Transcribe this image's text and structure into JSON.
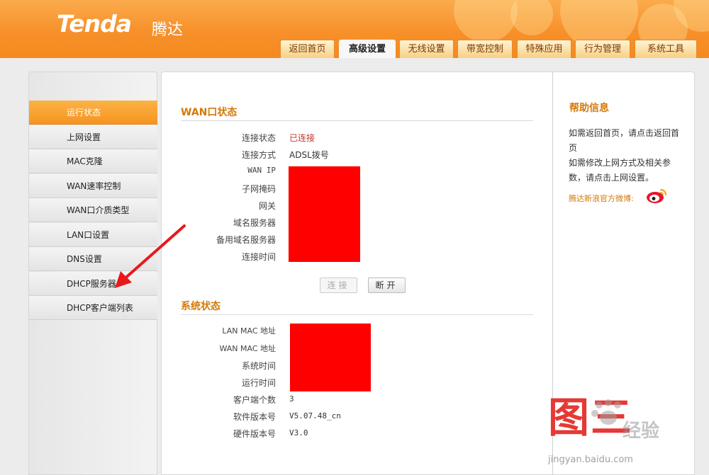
{
  "brand": {
    "logo_text": "Tenda",
    "logo_cn": "腾达"
  },
  "nav_tabs": [
    {
      "label": "返回首页"
    },
    {
      "label": "高级设置",
      "active": true
    },
    {
      "label": "无线设置"
    },
    {
      "label": "带宽控制"
    },
    {
      "label": "特殊应用"
    },
    {
      "label": "行为管理"
    },
    {
      "label": "系统工具"
    }
  ],
  "sidebar": {
    "items": [
      {
        "label": "运行状态",
        "active": true
      },
      {
        "label": "上网设置"
      },
      {
        "label": "MAC克隆"
      },
      {
        "label": "WAN速率控制"
      },
      {
        "label": "WAN口介质类型"
      },
      {
        "label": "LAN口设置"
      },
      {
        "label": "DNS设置"
      },
      {
        "label": "DHCP服务器"
      },
      {
        "label": "DHCP客户端列表"
      }
    ]
  },
  "wan_status": {
    "title": "WAN口状态",
    "rows": [
      {
        "label": "连接状态",
        "value": "已连接"
      },
      {
        "label": "连接方式",
        "value": "ADSL拨号"
      },
      {
        "label": "WAN IP",
        "value": ""
      },
      {
        "label": "子网掩码",
        "value": ""
      },
      {
        "label": "网关",
        "value": ""
      },
      {
        "label": "域名服务器",
        "value": ""
      },
      {
        "label": "备用域名服务器",
        "value": ""
      },
      {
        "label": "连接时间",
        "value": ""
      }
    ],
    "connect_button": "连接",
    "disconnect_button": "断开"
  },
  "system_status": {
    "title": "系统状态",
    "rows": [
      {
        "label": "LAN MAC 地址",
        "value": ""
      },
      {
        "label": "WAN MAC 地址",
        "value": ""
      },
      {
        "label": "系统时间",
        "value": ""
      },
      {
        "label": "运行时间",
        "value": ""
      },
      {
        "label": "客户端个数",
        "value": "3"
      },
      {
        "label": "软件版本号",
        "value": "V5.07.48_cn"
      },
      {
        "label": "硬件版本号",
        "value": "V3.0"
      }
    ]
  },
  "help": {
    "title": "帮助信息",
    "text": "如需返回首页，请点击返回首页\n如需修改上网方式及相关参数，请点击上网设置。",
    "weibo_label": "腾达新浪官方微博:"
  },
  "watermark": {
    "char1": "图",
    "char2": "三",
    "site": "经验",
    "url": "jingyan.baidu.com"
  },
  "colors": {
    "accent": "#f6941f",
    "section_title": "#d47a07",
    "redaction": "#ff0000"
  }
}
